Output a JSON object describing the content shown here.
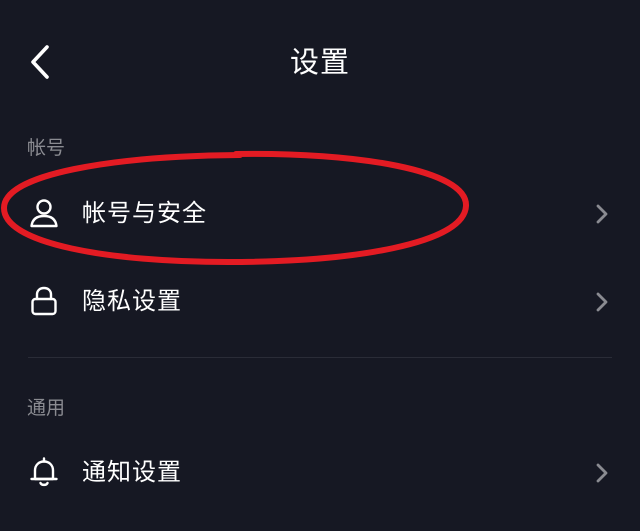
{
  "header": {
    "title": "设置",
    "back_icon": "chevron-left-icon"
  },
  "sections": [
    {
      "label": "帐号",
      "items": [
        {
          "label": "帐号与安全",
          "icon": "person-icon"
        },
        {
          "label": "隐私设置",
          "icon": "lock-icon"
        }
      ]
    },
    {
      "label": "通用",
      "items": [
        {
          "label": "通知设置",
          "icon": "bell-icon"
        }
      ]
    }
  ],
  "colors": {
    "background": "#161823",
    "text_primary": "#ffffff",
    "text_secondary": "#8a8b91",
    "divider": "#2a2c37",
    "annotation_circle": "#e31b23"
  }
}
